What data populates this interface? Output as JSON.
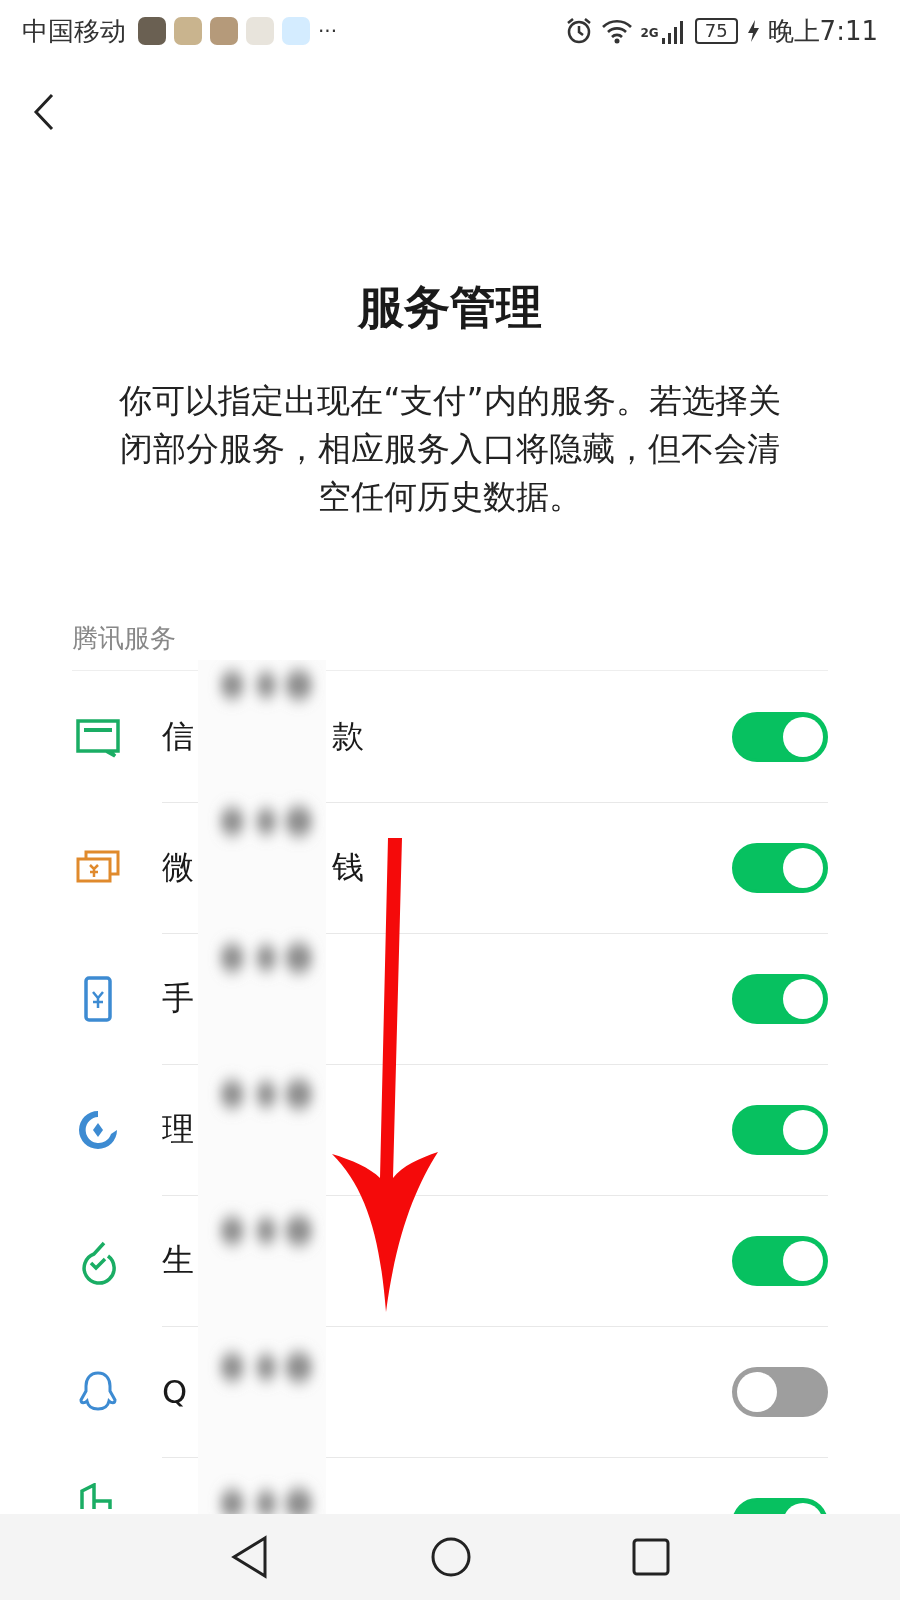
{
  "status_bar": {
    "carrier": "中国移动",
    "more": "···",
    "network": "2G",
    "battery": "75",
    "time": "晚上7:11"
  },
  "title": "服务管理",
  "description": "你可以指定出现在“支付”内的服务。若选择关闭部分服务，相应服务入口将隐藏，但不会清空任何历史数据。",
  "section": "腾讯服务",
  "services": [
    {
      "kind": "card",
      "label_start": "信",
      "label_end": "款",
      "on": true
    },
    {
      "kind": "money",
      "label_start": "微",
      "label_end": "钱",
      "on": true
    },
    {
      "kind": "phone",
      "label_start": "手",
      "on": true
    },
    {
      "kind": "wealth",
      "label_start": "理",
      "on": true
    },
    {
      "kind": "life",
      "label_start": "生",
      "on": true
    },
    {
      "kind": "qq",
      "label_start": "Q",
      "on": false
    },
    {
      "kind": "city",
      "on": true
    }
  ]
}
